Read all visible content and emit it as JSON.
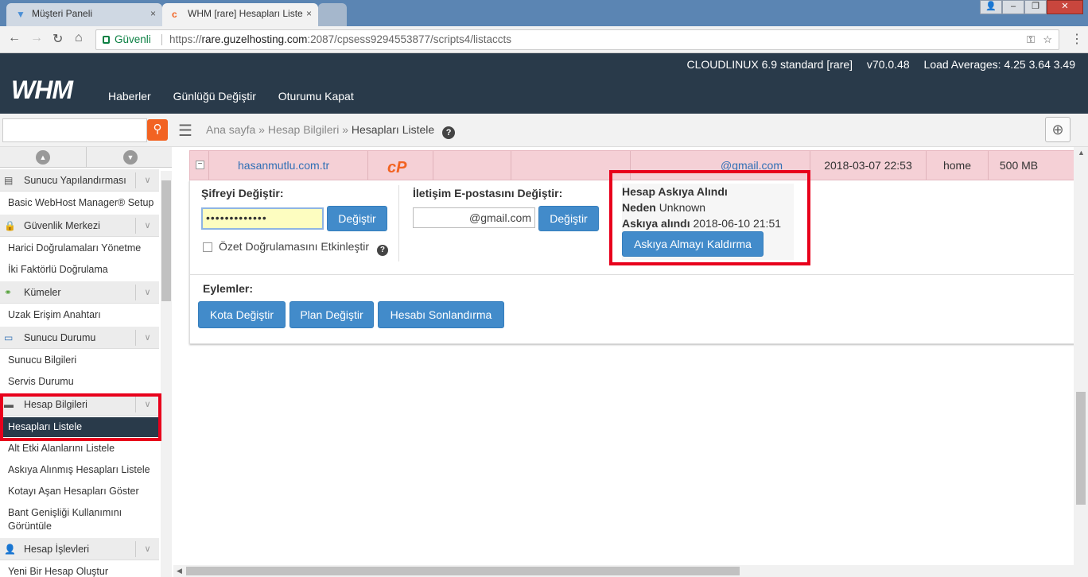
{
  "browser": {
    "tabs": [
      {
        "title": "Müşteri Paneli",
        "close": "×"
      },
      {
        "title": "WHM [rare] Hesapları Liste",
        "close": "×"
      }
    ],
    "secure_label": "Güvenli",
    "url_scheme": "https://",
    "url_host": "rare.guzelhosting.com",
    "url_rest": ":2087/cpsess9294553877/scripts4/listaccts"
  },
  "header": {
    "os": "CLOUDLINUX 6.9 standard [rare]",
    "version": "v70.0.48",
    "load": "Load Averages: 4.25 3.64 3.49",
    "logo": "WHM",
    "nav": [
      "Haberler",
      "Günlüğü Değiştir",
      "Oturumu Kapat"
    ]
  },
  "breadcrumb": {
    "home": "Ana sayfa",
    "sep": "»",
    "parent": "Hesap Bilgileri",
    "current": "Hesapları Listele"
  },
  "sidebar": {
    "groups": [
      {
        "label": "Sunucu Yapılandırması",
        "icon": "server-config-icon"
      },
      {
        "label": "Güvenlik Merkezi",
        "icon": "lock-icon"
      },
      {
        "label": "Kümeler",
        "icon": "cluster-icon"
      },
      {
        "label": "Sunucu Durumu",
        "icon": "server-status-icon"
      },
      {
        "label": "Hesap Bilgileri",
        "icon": "account-info-icon"
      },
      {
        "label": "Hesap İşlevleri",
        "icon": "account-functions-icon"
      }
    ],
    "items": {
      "basic_setup": "Basic WebHost Manager® Setup",
      "external_auth": "Harici Doğrulamaları Yönetme",
      "two_factor": "İki Faktörlü Doğrulama",
      "remote_access": "Uzak Erişim Anahtarı",
      "server_info": "Sunucu Bilgileri",
      "service_status": "Servis Durumu",
      "list_accounts": "Hesapları Listele",
      "list_subdomains": "Alt Etki Alanlarını Listele",
      "list_suspended": "Askıya Alınmış Hesapları Listele",
      "over_quota": "Kotayı Aşan Hesapları Göster",
      "bandwidth_1": "Bant Genişliği Kullanımını",
      "bandwidth_2": "Görüntüle",
      "create_account": "Yeni Bir Hesap Oluştur"
    }
  },
  "account": {
    "collapse": "−",
    "domain": "hasanmutlu.com.tr",
    "cp_logo": "cP",
    "email": "@gmail.com",
    "date": "2018-03-07 22:53",
    "partition": "home",
    "quota": "500 MB"
  },
  "panel": {
    "password_label": "Şifreyi Değiştir:",
    "password_value": "•••••••••••••",
    "change_btn": "Değiştir",
    "digest_label": "Özet Doğrulamasını Etkinleştir",
    "email_label": "İletişim E-postasını Değiştir:",
    "email_value": "@gmail.com",
    "suspended_title": "Hesap Askıya Alındı",
    "reason_label": "Neden",
    "reason_value": "Unknown",
    "suspended_at_label": "Askıya alındı",
    "suspended_at_value": "2018-06-10 21:51",
    "unsuspend_btn": "Askıya Almayı Kaldırma",
    "actions_label": "Eylemler:",
    "actions": [
      "Kota Değiştir",
      "Plan Değiştir",
      "Hesabı Sonlandırma"
    ]
  },
  "colors": {
    "header_bg": "#293a4a",
    "accent_blue": "#428bca",
    "search_orange": "#f26322",
    "highlight_red": "#e8001c",
    "suspended_row": "#f5d0d6"
  }
}
